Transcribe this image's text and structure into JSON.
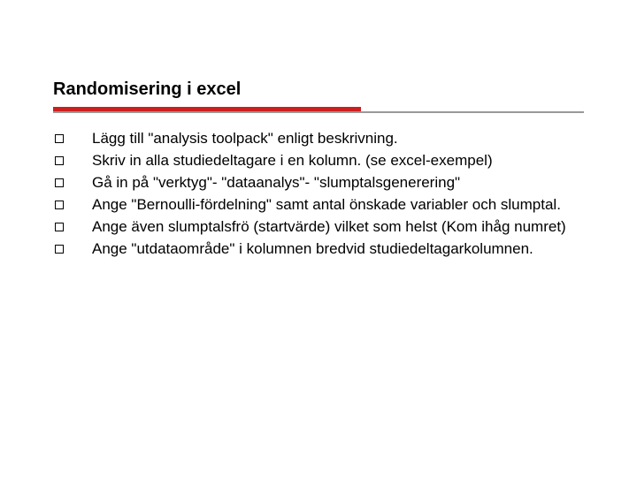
{
  "title": "Randomisering i excel",
  "items": [
    "Lägg till \"analysis toolpack\" enligt beskrivning.",
    "Skriv in alla studiedeltagare i en kolumn. (se excel-exempel)",
    "Gå in på \"verktyg\"- \"dataanalys\"- \"slumptalsgenerering\"",
    "Ange \"Bernoulli-fördelning\" samt antal önskade variabler och slumptal.",
    "Ange även slumptalsfrö (startvärde) vilket som helst (Kom ihåg numret)",
    "Ange \"utdataområde\" i kolumnen bredvid studiedeltagarkolumnen."
  ]
}
